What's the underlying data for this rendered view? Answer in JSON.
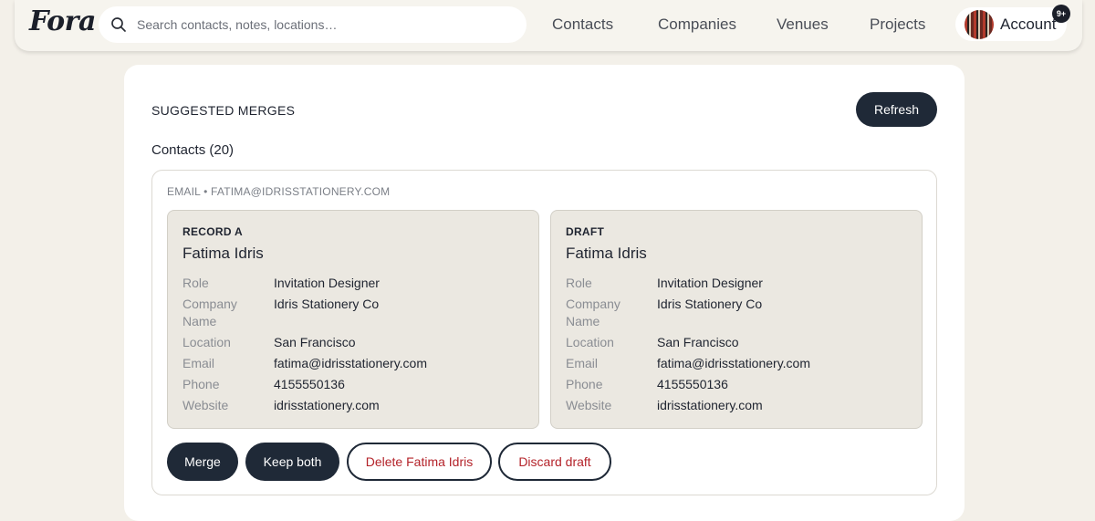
{
  "app": {
    "logo": "Fora"
  },
  "search": {
    "placeholder": "Search contacts, notes, locations…",
    "value": ""
  },
  "nav": {
    "contacts": "Contacts",
    "companies": "Companies",
    "venues": "Venues",
    "projects": "Projects"
  },
  "account": {
    "label": "Account",
    "badge": "9+"
  },
  "main": {
    "section_title": "SUGGESTED MERGES",
    "refresh_label": "Refresh",
    "contacts_count": "Contacts (20)"
  },
  "group": {
    "key": "EMAIL • FATIMA@IDRISSTATIONERY.COM",
    "records": [
      {
        "kind": "RECORD A",
        "name": "Fatima Idris",
        "fields": [
          {
            "label": "Role",
            "value": "Invitation Designer"
          },
          {
            "label": "Company Name",
            "value": "Idris Stationery Co"
          },
          {
            "label": "Location",
            "value": "San Francisco"
          },
          {
            "label": "Email",
            "value": "fatima@idrisstationery.com"
          },
          {
            "label": "Phone",
            "value": "4155550136"
          },
          {
            "label": "Website",
            "value": "idrisstationery.com"
          }
        ]
      },
      {
        "kind": "DRAFT",
        "name": "Fatima Idris",
        "fields": [
          {
            "label": "Role",
            "value": "Invitation Designer"
          },
          {
            "label": "Company Name",
            "value": "Idris Stationery Co"
          },
          {
            "label": "Location",
            "value": "San Francisco"
          },
          {
            "label": "Email",
            "value": "fatima@idrisstationery.com"
          },
          {
            "label": "Phone",
            "value": "4155550136"
          },
          {
            "label": "Website",
            "value": "idrisstationery.com"
          }
        ]
      }
    ],
    "actions": {
      "merge": "Merge",
      "keep_both": "Keep both",
      "delete": "Delete Fatima Idris",
      "discard": "Discard draft"
    }
  },
  "colors": {
    "background": "#f3f0e9",
    "primary_dark": "#1f2937",
    "danger_text": "#b4232a",
    "record_bg": "#ebe8e1"
  }
}
